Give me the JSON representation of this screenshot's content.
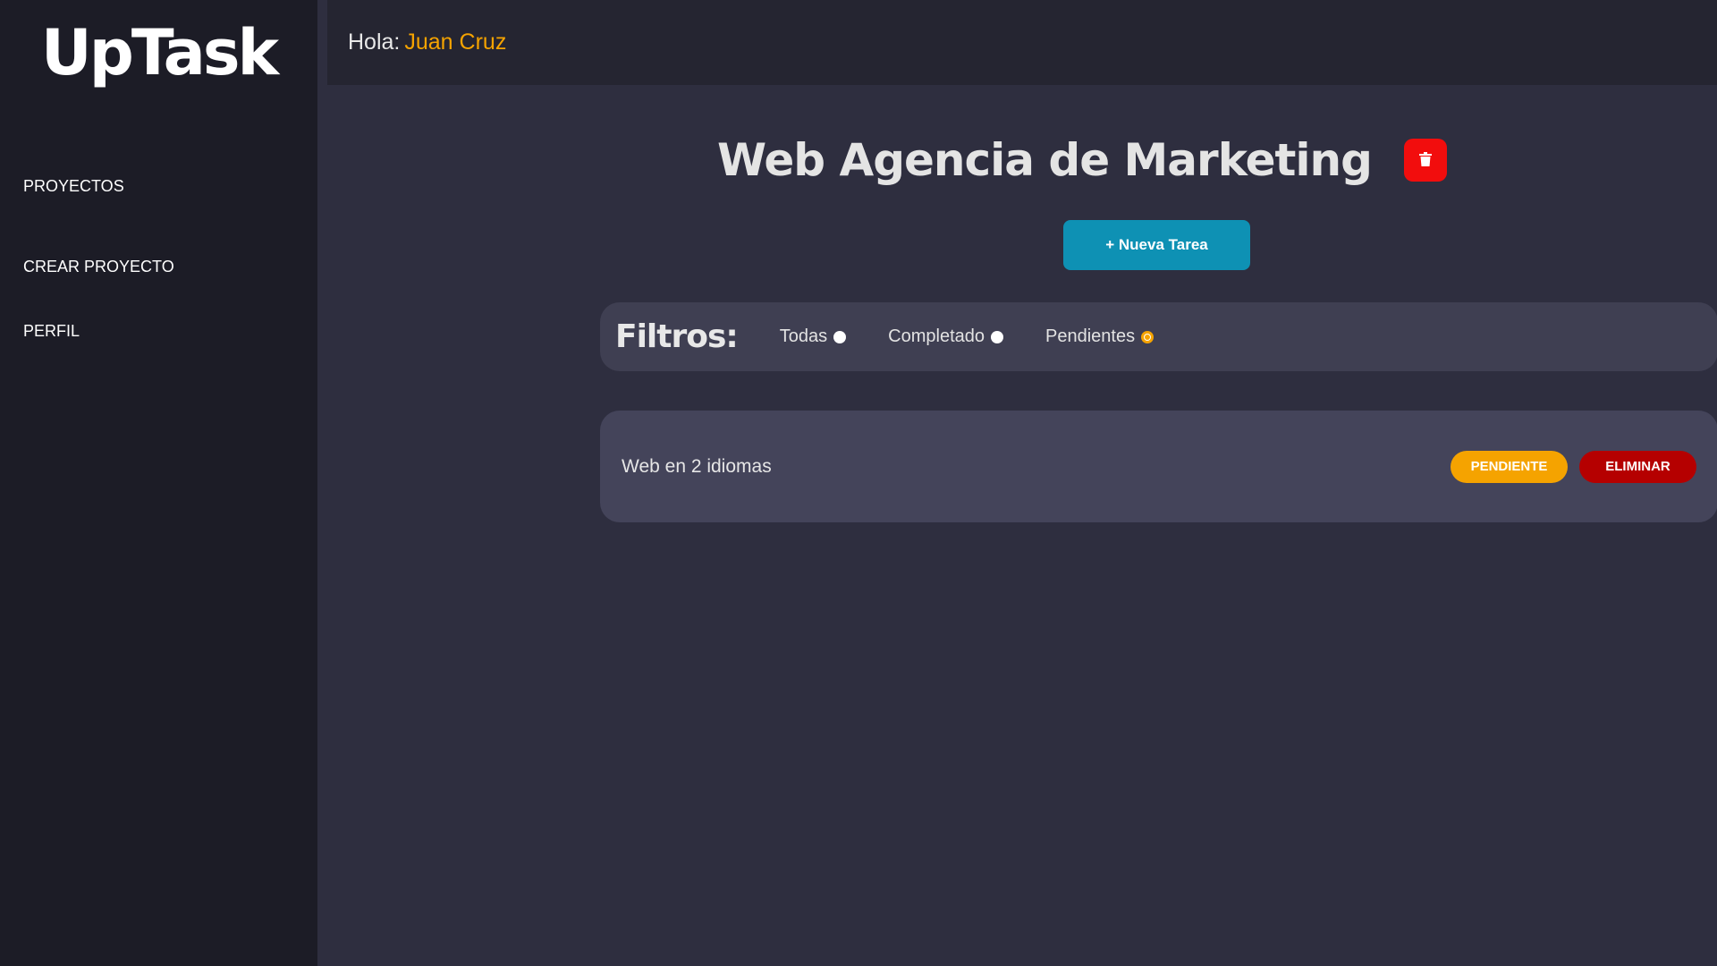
{
  "app": {
    "logo": "UpTask",
    "brand_colors": {
      "accent": "#f5a300",
      "primary": "#0e91b4",
      "danger": "#f20d0d"
    }
  },
  "sidebar": {
    "items": [
      {
        "label": "PROYECTOS"
      },
      {
        "label": "CREAR PROYECTO"
      },
      {
        "label": "PERFIL"
      }
    ]
  },
  "header": {
    "greeting": "Hola:",
    "user_name": "Juan Cruz"
  },
  "project": {
    "title": "Web Agencia de Marketing",
    "delete_icon": "trash-icon",
    "new_task_label": "+ Nueva Tarea"
  },
  "filters": {
    "title": "Filtros:",
    "options": [
      {
        "label": "Todas",
        "checked": false
      },
      {
        "label": "Completado",
        "checked": false
      },
      {
        "label": "Pendientes",
        "checked": true
      }
    ]
  },
  "tasks": [
    {
      "name": "Web en 2 idiomas",
      "status_label": "PENDIENTE",
      "delete_label": "ELIMINAR"
    }
  ]
}
